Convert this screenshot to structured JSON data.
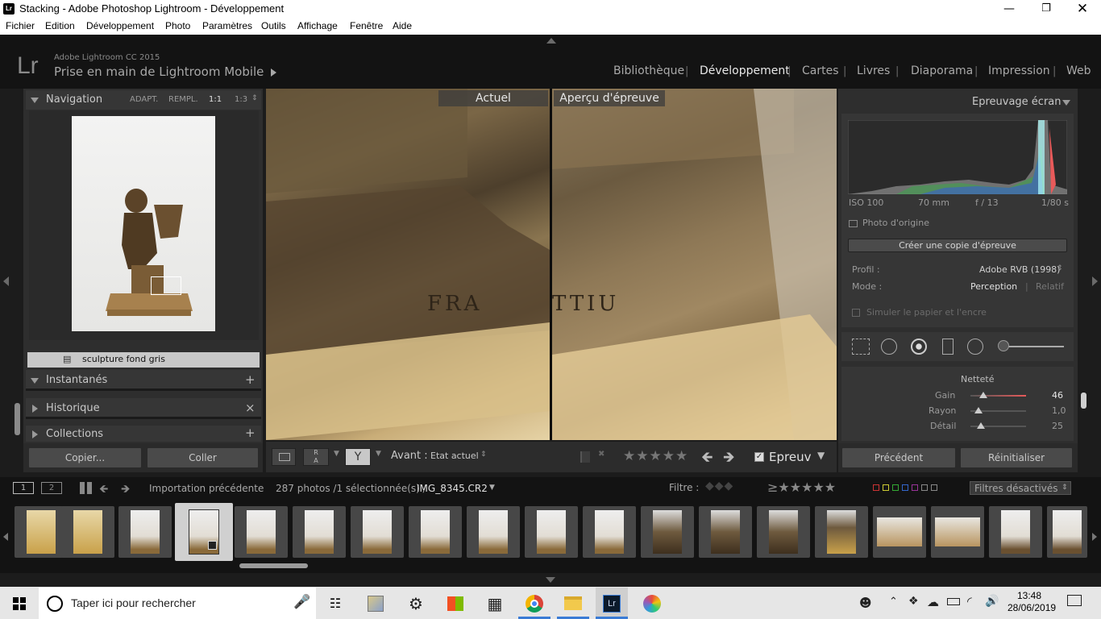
{
  "window": {
    "title": "Stacking - Adobe Photoshop Lightroom - Développement",
    "app_icon": "Lr"
  },
  "menu": [
    "Fichier",
    "Edition",
    "Développement",
    "Photo",
    "Paramètres",
    "Outils",
    "Affichage",
    "Fenêtre",
    "Aide"
  ],
  "header": {
    "logo": "Lr",
    "product": "Adobe Lightroom CC 2015",
    "catalog": "Prise en main de Lightroom Mobile",
    "modules": [
      "Bibliothèque",
      "Développement",
      "Cartes",
      "Livres",
      "Diaporama",
      "Impression",
      "Web"
    ],
    "active_module": "Développement"
  },
  "left": {
    "navigator": {
      "title": "Navigation",
      "zoom_options": [
        "ADAPT.",
        "REMPL.",
        "1:1",
        "1:3"
      ],
      "active_zoom": "1:1"
    },
    "collection_item": "sculpture fond gris",
    "panels": [
      {
        "label": "Instantanés",
        "action": "+"
      },
      {
        "label": "Historique",
        "action": "×"
      },
      {
        "label": "Collections",
        "action": "+"
      }
    ],
    "copy_label": "Copier...",
    "paste_label": "Coller"
  },
  "center": {
    "label_current": "Actuel",
    "label_proof": "Aperçu d'épreuve",
    "toolbar": {
      "before_label": "Avant :",
      "before_value": "Etat actuel",
      "proof_checkbox": "Epreuv",
      "proof_checked": true,
      "rating": 0
    }
  },
  "right": {
    "title": "Epreuvage écran",
    "exif": {
      "iso": "ISO 100",
      "focal": "70 mm",
      "aperture": "f / 13",
      "shutter": "1/80 s"
    },
    "original_photo": "Photo d'origine",
    "create_copy": "Créer une copie d'épreuve",
    "profile_label": "Profil :",
    "profile_value": "Adobe RVB (1998)",
    "mode_label": "Mode :",
    "mode_perception": "Perception",
    "mode_relative": "Relatif",
    "simulate": "Simuler le papier et l'encre",
    "sharpness": {
      "title": "Netteté",
      "rows": [
        {
          "label": "Gain",
          "value": "46"
        },
        {
          "label": "Rayon",
          "value": "1,0"
        },
        {
          "label": "Détail",
          "value": "25"
        }
      ]
    },
    "prev_label": "Précédent",
    "reset_label": "Réinitialiser"
  },
  "filmstrip_bar": {
    "screen1": "1",
    "screen2": "2",
    "source": "Importation précédente",
    "count": "287 photos /1 sélectionnée(s) /",
    "filename": "IMG_8345.CR2",
    "filter_label": "Filtre :",
    "filters_off": "Filtres désactivés"
  },
  "taskbar": {
    "search_placeholder": "Taper ici pour rechercher",
    "time": "13:48",
    "date": "28/06/2019"
  },
  "colors": {
    "lr_dark": "#131313",
    "panel": "#363636",
    "accent_red": "#e85a5a"
  }
}
